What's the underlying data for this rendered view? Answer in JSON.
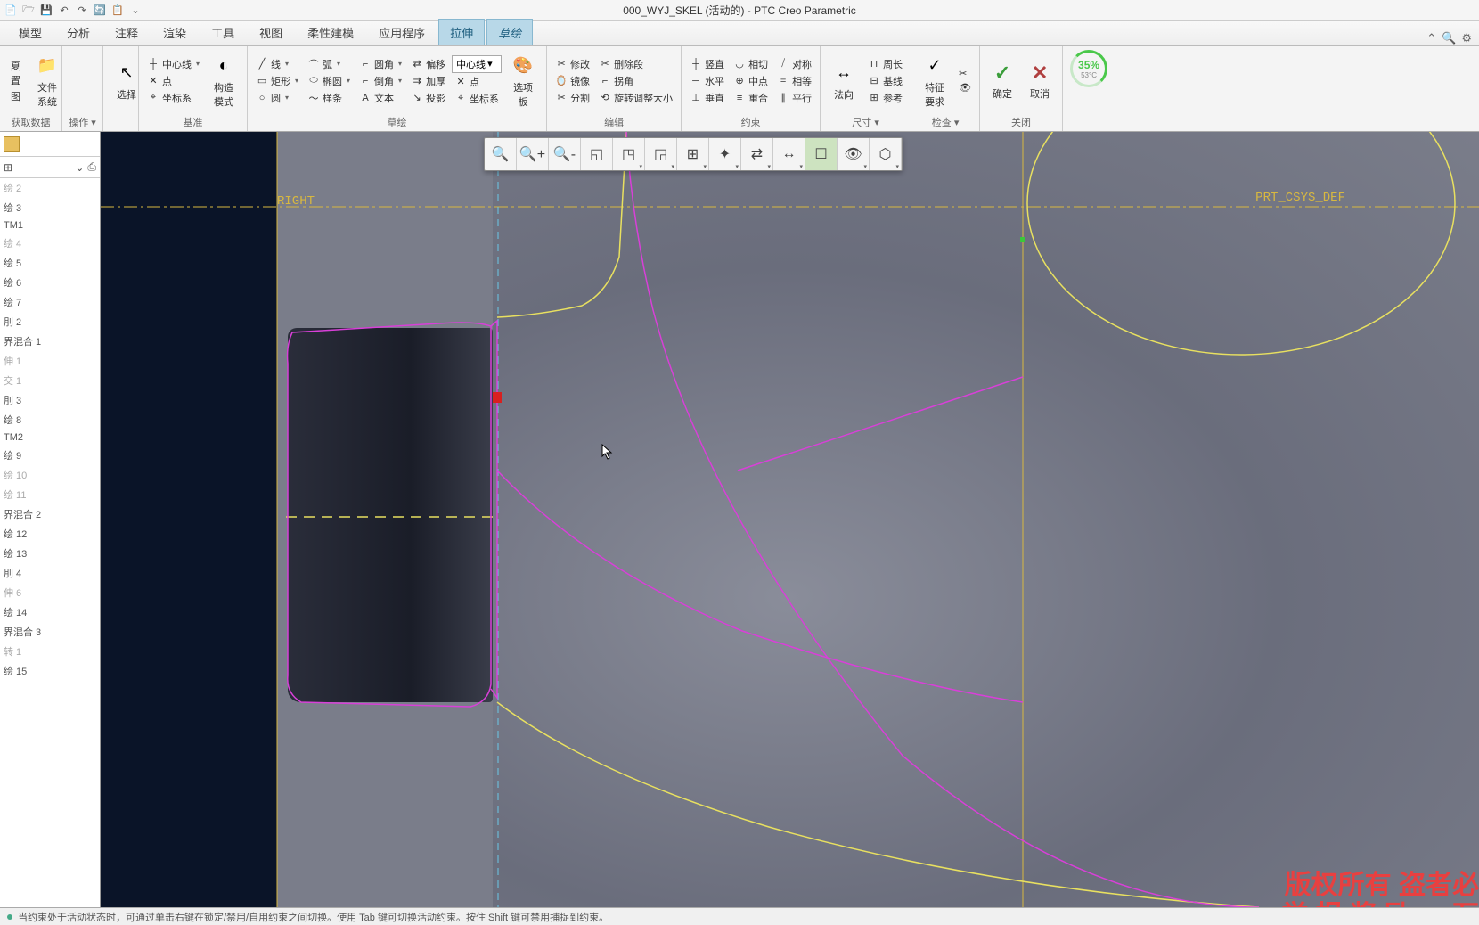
{
  "title": "000_WYJ_SKEL (活动的) - PTC Creo Parametric",
  "qat_icons": [
    "📄",
    "🗁",
    "💾",
    "↶",
    "↷",
    "🔄",
    "📋",
    "⌄"
  ],
  "title_right_icons": [
    "—",
    "□",
    "✕"
  ],
  "ribbon_right_icons": [
    "⌃",
    "🔍",
    "⚙"
  ],
  "tabs": [
    "模型",
    "分析",
    "注释",
    "渲染",
    "工具",
    "视图",
    "柔性建模",
    "应用程序"
  ],
  "tab_active": "拉伸",
  "tab_active2": "草绘",
  "groups": {
    "data": {
      "label": "获取数据",
      "btn1": "夏置",
      "btn2_ico": "📁",
      "btn2": "文件\n系统"
    },
    "op": {
      "label": "操作",
      "dd": "▾"
    },
    "select": {
      "label": "",
      "btn_ico": "↖",
      "btn": "选择"
    },
    "base": {
      "label": "基准",
      "items": [
        {
          "ico": "┼",
          "txt": "中心线",
          "dd": true
        },
        {
          "ico": "✕",
          "txt": "点"
        },
        {
          "ico": "⌖",
          "txt": "坐标系"
        }
      ],
      "btn_ico": "◐",
      "btn": "构造\n模式"
    },
    "sketch": {
      "label": "草绘",
      "col1": [
        {
          "ico": "╱",
          "txt": "线",
          "dd": true
        },
        {
          "ico": "▭",
          "txt": "矩形",
          "dd": true
        },
        {
          "ico": "○",
          "txt": "圆",
          "dd": true
        }
      ],
      "col2": [
        {
          "ico": "⌒",
          "txt": "弧",
          "dd": true
        },
        {
          "ico": "⬭",
          "txt": "椭圆",
          "dd": true
        },
        {
          "ico": "〜",
          "txt": "样条"
        }
      ],
      "col3": [
        {
          "ico": "⌐",
          "txt": "圆角",
          "dd": true
        },
        {
          "ico": "⌐",
          "txt": "倒角",
          "dd": true
        },
        {
          "ico": "A",
          "txt": "文本"
        }
      ],
      "col4": [
        {
          "ico": "⇄",
          "txt": "偏移"
        },
        {
          "ico": "⇉",
          "txt": "加厚"
        },
        {
          "ico": "↘",
          "txt": "投影"
        }
      ],
      "dropdown": "中心线",
      "col5": [
        {
          "ico": "✕",
          "txt": "点"
        },
        {
          "ico": "⌖",
          "txt": "坐标系"
        }
      ],
      "optbtn_ico": "🎨",
      "optbtn": "选项\n板"
    },
    "edit": {
      "label": "编辑",
      "items": [
        {
          "ico": "✂",
          "txt": "修改"
        },
        {
          "ico": "🪞",
          "txt": "镜像"
        },
        {
          "ico": "✂",
          "txt": "分割"
        },
        {
          "ico": "✂",
          "txt": "删除段"
        },
        {
          "ico": "⌐",
          "txt": "拐角"
        },
        {
          "ico": "⟲",
          "txt": "旋转调整大小"
        }
      ]
    },
    "constrain": {
      "label": "约束",
      "items": [
        {
          "ico": "┼",
          "txt": "竖直"
        },
        {
          "ico": "─",
          "txt": "水平"
        },
        {
          "ico": "⊥",
          "txt": "垂直"
        },
        {
          "ico": "◡",
          "txt": "相切"
        },
        {
          "ico": "⊕",
          "txt": "中点"
        },
        {
          "ico": "≡",
          "txt": "重合"
        },
        {
          "ico": "⧸",
          "txt": "对称"
        },
        {
          "ico": "=",
          "txt": "相等"
        },
        {
          "ico": "∥",
          "txt": "平行"
        }
      ]
    },
    "dim": {
      "label": "尺寸",
      "btn_ico": "↔",
      "btn": "法向",
      "items": [
        {
          "ico": "⊓",
          "txt": "周长"
        },
        {
          "ico": "⊟",
          "txt": "基线"
        },
        {
          "ico": "⊞",
          "txt": "参考"
        }
      ]
    },
    "check": {
      "label": "检查",
      "btn_ico": "✓",
      "btn": "特征\n要求",
      "ico1": "✂",
      "ico2": "👁",
      "dd": "▾"
    },
    "close": {
      "label": "关闭",
      "ok": "确定",
      "cancel": "取消"
    },
    "gauge": {
      "val": "35%",
      "sub": "53°C"
    }
  },
  "tree": [
    {
      "txt": "绘 2",
      "dim": true
    },
    {
      "txt": "绘 3"
    },
    {
      "txt": "TM1"
    },
    {
      "txt": "绘 4",
      "dim": true
    },
    {
      "txt": "绘 5"
    },
    {
      "txt": "绘 6"
    },
    {
      "txt": "绘 7"
    },
    {
      "txt": "刖 2"
    },
    {
      "txt": "界混合 1"
    },
    {
      "txt": "伸 1",
      "dim": true
    },
    {
      "txt": "交 1",
      "dim": true
    },
    {
      "txt": "刖 3"
    },
    {
      "txt": "绘 8"
    },
    {
      "txt": "TM2"
    },
    {
      "txt": "绘 9"
    },
    {
      "txt": "绘 10",
      "dim": true
    },
    {
      "txt": "绘 11",
      "dim": true
    },
    {
      "txt": "界混合 2"
    },
    {
      "txt": "绘 12"
    },
    {
      "txt": "绘 13"
    },
    {
      "txt": "刖 4"
    },
    {
      "txt": "伸 6",
      "dim": true
    },
    {
      "txt": "绘 14"
    },
    {
      "txt": "界混合 3"
    },
    {
      "txt": "转 1",
      "dim": true
    },
    {
      "txt": "绘 15"
    }
  ],
  "float_tools": [
    {
      "ico": "🔍",
      "name": "zoom-refit-icon"
    },
    {
      "ico": "🔍+",
      "name": "zoom-in-icon"
    },
    {
      "ico": "🔍-",
      "name": "zoom-out-icon"
    },
    {
      "ico": "◱",
      "name": "repaint-icon"
    },
    {
      "ico": "◳",
      "name": "display-style-icon",
      "dd": true
    },
    {
      "ico": "◲",
      "name": "saved-views-icon",
      "dd": true
    },
    {
      "ico": "⊞",
      "name": "view-mgr-icon",
      "dd": true
    },
    {
      "ico": "✦",
      "name": "datum-axis-icon",
      "dd": true
    },
    {
      "ico": "⇄",
      "name": "datum-point-icon",
      "dd": true
    },
    {
      "ico": "↔",
      "name": "datum-plane-icon",
      "dd": true
    },
    {
      "ico": "☐",
      "name": "annotation-icon",
      "active": true
    },
    {
      "ico": "👁",
      "name": "spin-icon",
      "dd": true
    },
    {
      "ico": "⬡",
      "name": "perspective-icon",
      "dd": true
    }
  ],
  "datum_labels": {
    "right": "RIGHT",
    "csys": "PRT_CSYS_DEF"
  },
  "watermark": {
    "l1": "版权所有 盗者必",
    "l2": "举 报 奖 励 一 万"
  },
  "status": "当约束处于活动状态时，可通过单击右键在锁定/禁用/自用约束之间切换。使用 Tab 键可切换活动约束。按住 Shift 键可禁用捕捉到约束。",
  "sidebar_tools": [
    "⊞",
    "⌄",
    "⎙",
    "⋮"
  ]
}
